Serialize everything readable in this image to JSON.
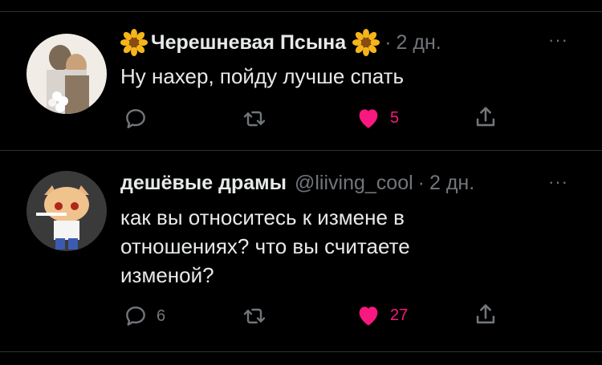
{
  "colors": {
    "background": "#000000",
    "text": "#e7e9ea",
    "muted": "#71767b",
    "like": "#f91880",
    "divider": "#2f3336"
  },
  "tweets": [
    {
      "display_name": "Черешневая Псына",
      "name_decoration_icon": "sunflower-icon",
      "handle": "",
      "dot": "·",
      "time": "2 дн.",
      "more": "···",
      "text": "Ну нахер, пойду лучше спать",
      "actions": {
        "reply_count": "",
        "retweet_count": "",
        "like_count": "5",
        "liked": true
      }
    },
    {
      "display_name": "дешёвые драмы",
      "handle": "@liiving_cool",
      "dot": "·",
      "time": "2 дн.",
      "more": "···",
      "text_lines": [
        "как вы относитесь к измене в",
        "отношениях? что вы считаете",
        "изменой?"
      ],
      "actions": {
        "reply_count": "6",
        "retweet_count": "",
        "like_count": "27",
        "liked": true
      }
    }
  ]
}
